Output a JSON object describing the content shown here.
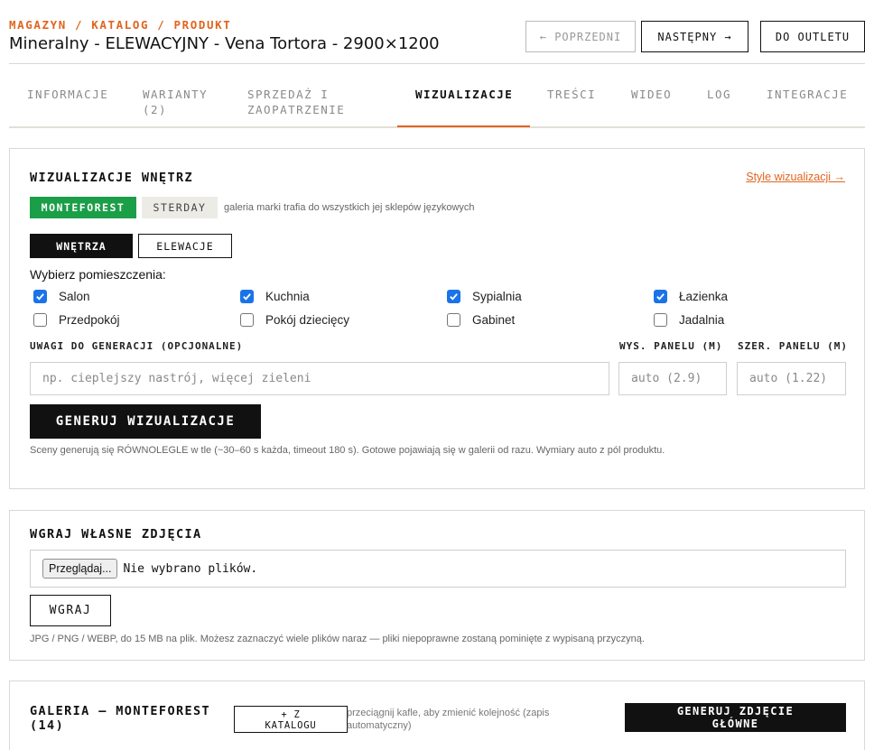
{
  "header": {
    "breadcrumb": "MAGAZYN / KATALOG / PRODUKT",
    "title": "Mineralny - ELEWACYJNY - Vena Tortora - 2900×1200",
    "prev_label": "← POPRZEDNI",
    "next_label": "NASTĘPNY →",
    "outlet_label": "DO OUTLETU"
  },
  "tabs": [
    {
      "label": "INFORMACJE",
      "active": false
    },
    {
      "label": "WARIANTY (2)",
      "active": false
    },
    {
      "label": "SPRZEDAŻ I ZAOPATRZENIE",
      "active": false
    },
    {
      "label": "WIZUALIZACJE",
      "active": true
    },
    {
      "label": "TREŚCI",
      "active": false
    },
    {
      "label": "WIDEO",
      "active": false
    },
    {
      "label": "LOG",
      "active": false
    },
    {
      "label": "INTEGRACJE",
      "active": false
    }
  ],
  "viz": {
    "title": "WIZUALIZACJE WNĘTRZ",
    "styles_link": "Style wizualizacji →",
    "brands": [
      "MONTEFOREST",
      "STERDAY"
    ],
    "brand_note": "galeria marki trafia do wszystkich jej sklepów językowych",
    "modes": [
      "WNĘTRZA",
      "ELEWACJE"
    ],
    "rooms_label": "Wybierz pomieszczenia:",
    "rooms": [
      {
        "label": "Salon",
        "checked": true
      },
      {
        "label": "Kuchnia",
        "checked": true
      },
      {
        "label": "Sypialnia",
        "checked": true
      },
      {
        "label": "Łazienka",
        "checked": true
      },
      {
        "label": "Przedpokój",
        "checked": false
      },
      {
        "label": "Pokój dziecięcy",
        "checked": false
      },
      {
        "label": "Gabinet",
        "checked": false
      },
      {
        "label": "Jadalnia",
        "checked": false
      }
    ],
    "notes_label": "UWAGI DO GENERACJI (OPCJONALNE)",
    "notes_placeholder": "np. cieplejszy nastrój, więcej zieleni",
    "height_label": "WYS. PANELU (M)",
    "height_placeholder": "auto (2.9)",
    "width_label": "SZER. PANELU (M)",
    "width_placeholder": "auto (1.22)",
    "generate_label": "GENERUJ WIZUALIZACJE",
    "hint": "Sceny generują się RÓWNOLEGLE w tle (~30–60 s każda, timeout 180 s). Gotowe pojawiają się w galerii od razu. Wymiary auto z pól produktu."
  },
  "upload": {
    "title": "WGRAJ WŁASNE ZDJĘCIA",
    "browse_label": "Przeglądaj...",
    "no_files": "Nie wybrano plików.",
    "upload_label": "WGRAJ",
    "hint": "JPG / PNG / WEBP, do 15 MB na plik. Możesz zaznaczyć wiele plików naraz — pliki niepoprawne zostaną pominięte z wypisaną przyczyną."
  },
  "gallery": {
    "title_line1": "GALERIA — MONTEFOREST",
    "title_line2": "(14)",
    "from_catalog_line1": "+ Z",
    "from_catalog_line2": "KATALOGU",
    "drag_note": "przeciągnij kafle, aby zmienić kolejność (zapis automatyczny)",
    "main_photo_line1": "GENERUJ ZDJĘCIE",
    "main_photo_line2": "GŁÓWNE"
  },
  "colors": {
    "accent": "#e0651f",
    "brand_active": "#1b9e48",
    "checkbox": "#1a73e8"
  }
}
